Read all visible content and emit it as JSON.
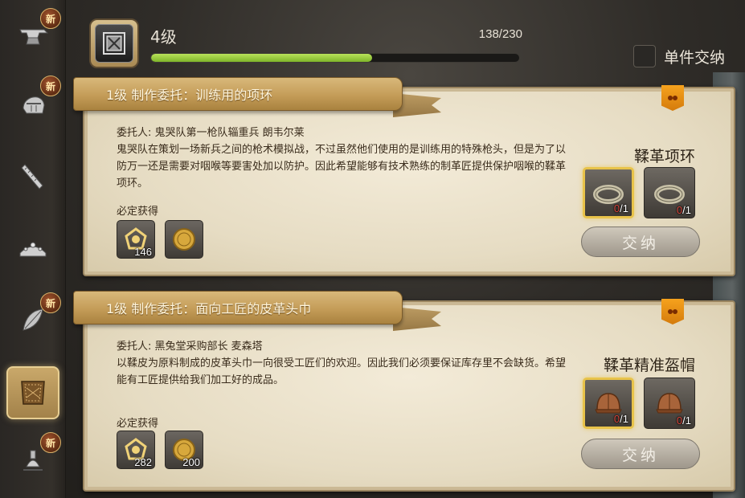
{
  "sidebar": {
    "badge_text": "新",
    "items": [
      {
        "icon": "anvil-icon",
        "badge": true
      },
      {
        "icon": "helmet-icon",
        "badge": true
      },
      {
        "icon": "saw-icon",
        "badge": false
      },
      {
        "icon": "tiara-icon",
        "badge": false
      },
      {
        "icon": "leaf-bow-icon",
        "badge": true
      },
      {
        "icon": "leather-icon",
        "badge": false,
        "active": true
      },
      {
        "icon": "alchemy-icon",
        "badge": true
      }
    ]
  },
  "header": {
    "level_label": "4级",
    "exp_text": "138/230",
    "exp_progress": 0.6,
    "single_submit_label": "单件交纳"
  },
  "quests": [
    {
      "title": "1级  制作委托：训练用的项环",
      "client": "委托人: 鬼哭队第一枪队辎重兵 朗韦尔莱",
      "description": "鬼哭队在策划一场新兵之间的枪术模拟战，不过虽然他们使用的是训练用的特殊枪头，但是为了以防万一还是需要对咽喉等要害处加以防护。因此希望能够有技术熟练的制革匠提供保护咽喉的鞣革项环。",
      "reward_label": "必定获得",
      "rewards": [
        {
          "icon": "crafter-scrip-icon",
          "count": "146"
        },
        {
          "icon": "gil-coin-icon",
          "count": ""
        }
      ],
      "target_item": "鞣革项环",
      "slots": [
        {
          "icon": "leather-choker-icon",
          "have": "0",
          "need": "/1",
          "selected": true
        },
        {
          "icon": "leather-choker-icon",
          "have": "0",
          "need": "/1",
          "selected": false
        }
      ],
      "submit_label": "交纳"
    },
    {
      "title": "1级  制作委托：面向工匠的皮革头巾",
      "client": "委托人: 黑兔堂采购部长 麦森塔",
      "description": "以鞣皮为原料制成的皮革头巾一向很受工匠们的欢迎。因此我们必须要保证库存里不会缺货。希望能有工匠提供给我们加工好的成品。",
      "reward_label": "必定获得",
      "rewards": [
        {
          "icon": "crafter-scrip-icon",
          "count": "282"
        },
        {
          "icon": "gil-coin-icon",
          "count": "200"
        }
      ],
      "target_item": "鞣革精准盔帽",
      "slots": [
        {
          "icon": "leather-cap-icon",
          "have": "0",
          "need": "/1",
          "selected": true
        },
        {
          "icon": "leather-cap-icon",
          "have": "0",
          "need": "/1",
          "selected": false
        }
      ],
      "submit_label": "交纳"
    }
  ]
}
